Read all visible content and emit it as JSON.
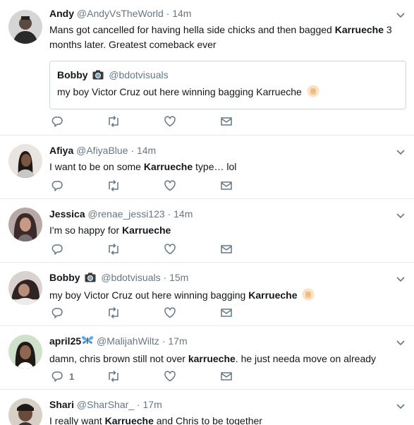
{
  "tweets": [
    {
      "name": "Andy",
      "handle": "@AndyVsTheWorld",
      "sep": "·",
      "time": "14m",
      "body_before": "Mans got cancelled for having hella side chicks and then bagged ",
      "body_bold": "Karrueche",
      "body_after": " 3 months later. Greatest comeback ever",
      "quote": {
        "name": "Bobby",
        "handle": "@bdotvisuals",
        "text": "my boy Victor Cruz out here winning bagging Karrueche"
      }
    },
    {
      "name": "Afiya",
      "handle": "@AfiyaBlue",
      "sep": "·",
      "time": "14m",
      "body_before": "I want to be on some ",
      "body_bold": "Karrueche",
      "body_after": " type… lol"
    },
    {
      "name": "Jessica",
      "handle": "@renae_jessi123",
      "sep": "·",
      "time": "14m",
      "body_before": "I'm so happy for ",
      "body_bold": "Karrueche",
      "body_after": ""
    },
    {
      "name": "Bobby",
      "handle": "@bdotvisuals",
      "sep": "·",
      "time": "15m",
      "body_before": "my boy Victor Cruz out here winning bagging ",
      "body_bold": "Karrueche",
      "body_after": ""
    },
    {
      "name": "april25",
      "handle": "@MalijahWiltz",
      "sep": "·",
      "time": "17m",
      "body_before": "damn, chris brown still not over ",
      "body_bold": "karrueche",
      "body_after": ". he just needa move on already",
      "reply_count": "1"
    },
    {
      "name": "Shari",
      "handle": "@SharShar_",
      "sep": "·",
      "time": "17m",
      "body_before": "I really want ",
      "body_bold": "Karrueche",
      "body_after": " and Chris to be together"
    }
  ],
  "icons": {
    "reply": "reply-icon",
    "retweet": "retweet-icon",
    "like": "heart-icon",
    "dm": "envelope-icon",
    "caret": "chevron-down-icon",
    "emoji": "raised-fist-emoji",
    "camera": "camera-emoji",
    "butterfly": "butterfly-emoji"
  },
  "colors": {
    "text": "#14171a",
    "secondary": "#657786",
    "border": "#e6ecf0",
    "quote_border": "#ccd6dd"
  }
}
